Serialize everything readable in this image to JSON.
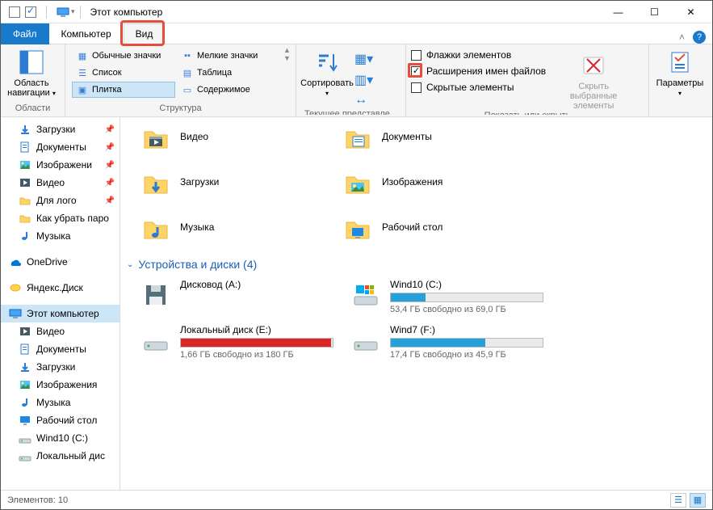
{
  "window": {
    "title": "Этот компьютер"
  },
  "tabs": {
    "file": "Файл",
    "computer": "Компьютер",
    "view": "Вид"
  },
  "ribbon": {
    "nav_group": {
      "button": "Область навигации",
      "label": "Области"
    },
    "layout_group": {
      "label": "Структура",
      "opts": {
        "normal_icons": "Обычные значки",
        "small_icons": "Мелкие значки",
        "list": "Список",
        "table": "Таблица",
        "tiles": "Плитка",
        "content": "Содержимое"
      }
    },
    "current_view_group": {
      "sort": "Сортировать",
      "label": "Текущее представле..."
    },
    "show_hide_group": {
      "checkboxes": "Флажки элементов",
      "extensions": "Расширения имен файлов",
      "hidden": "Скрытые элементы",
      "hide_selected": "Скрыть выбранные элементы",
      "label": "Показать или скрыть"
    },
    "options_group": {
      "button": "Параметры"
    }
  },
  "nav": {
    "quick": [
      {
        "label": "Загрузки",
        "pin": true,
        "icon": "downloads"
      },
      {
        "label": "Документы",
        "pin": true,
        "icon": "documents"
      },
      {
        "label": "Изображени",
        "pin": true,
        "icon": "pictures"
      },
      {
        "label": "Видео",
        "pin": true,
        "icon": "video"
      },
      {
        "label": "Для лого",
        "pin": true,
        "icon": "folder"
      },
      {
        "label": "Как убрать паро",
        "pin": false,
        "icon": "folder"
      },
      {
        "label": "Музыка",
        "pin": false,
        "icon": "music"
      }
    ],
    "onedrive": "OneDrive",
    "yandex": "Яндекс.Диск",
    "thispc": "Этот компьютер",
    "thispc_children": [
      {
        "label": "Видео",
        "icon": "video"
      },
      {
        "label": "Документы",
        "icon": "documents"
      },
      {
        "label": "Загрузки",
        "icon": "downloads"
      },
      {
        "label": "Изображения",
        "icon": "pictures"
      },
      {
        "label": "Музыка",
        "icon": "music"
      },
      {
        "label": "Рабочий стол",
        "icon": "desktop"
      },
      {
        "label": "Wind10 (C:)",
        "icon": "drive"
      },
      {
        "label": "Локальный дис",
        "icon": "drive"
      }
    ]
  },
  "content": {
    "folders": {
      "left": [
        {
          "label": "Видео",
          "icon": "video"
        },
        {
          "label": "Загрузки",
          "icon": "downloads"
        },
        {
          "label": "Музыка",
          "icon": "music"
        }
      ],
      "right": [
        {
          "label": "Документы",
          "icon": "documents"
        },
        {
          "label": "Изображения",
          "icon": "pictures"
        },
        {
          "label": "Рабочий стол",
          "icon": "desktop"
        }
      ]
    },
    "drives_header": "Устройства и диски (4)",
    "drives": [
      {
        "name": "Дисковод (A:)",
        "icon": "floppy",
        "bar": false
      },
      {
        "name": "Wind10 (C:)",
        "icon": "windrive",
        "free_text": "53,4 ГБ свободно из 69,0 ГБ",
        "fill_pct": 23,
        "color": "#26a0da"
      },
      {
        "name": "Локальный диск (E:)",
        "icon": "hdd",
        "free_text": "1,66 ГБ свободно из 180 ГБ",
        "fill_pct": 99,
        "color": "#da2626"
      },
      {
        "name": "Wind7 (F:)",
        "icon": "hdd",
        "free_text": "17,4 ГБ свободно из 45,9 ГБ",
        "fill_pct": 62,
        "color": "#26a0da"
      }
    ]
  },
  "status": {
    "items": "Элементов: 10"
  }
}
